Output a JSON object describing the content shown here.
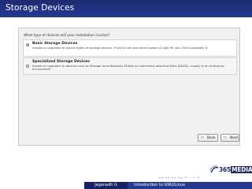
{
  "slide": {
    "title": "Storage Devices"
  },
  "installer": {
    "question": "What type of devices will your installation involve?",
    "options": [
      {
        "title": "Basic Storage Devices",
        "description": "Installs or upgrades to typical types of storage devices.  If you're not sure which option is right for you, this is probably it.",
        "selected": true
      },
      {
        "title": "Specialized Storage Devices",
        "description": "Installs or upgrades to devices such as Storage Area Networks (SANs) or mainframe attached disks (DASD), usually in an enterprise environment",
        "selected": false
      }
    ],
    "back_label": "Back",
    "next_label": "Next"
  },
  "logo": {
    "text_a": "365",
    "text_b": "MEDIA"
  },
  "nav": {
    "symbols": "◂ ▸ ◂ ▸ ◂ ▸ ◂ ▸  ≡ ∽∾ ↺"
  },
  "footer": {
    "author": "Jaganadh G",
    "title": "Introduction to GNU/Linux"
  },
  "colors": {
    "title_bar": "#253a8f",
    "footer_dark": "#1a2266",
    "footer_mid": "#253a8f"
  }
}
